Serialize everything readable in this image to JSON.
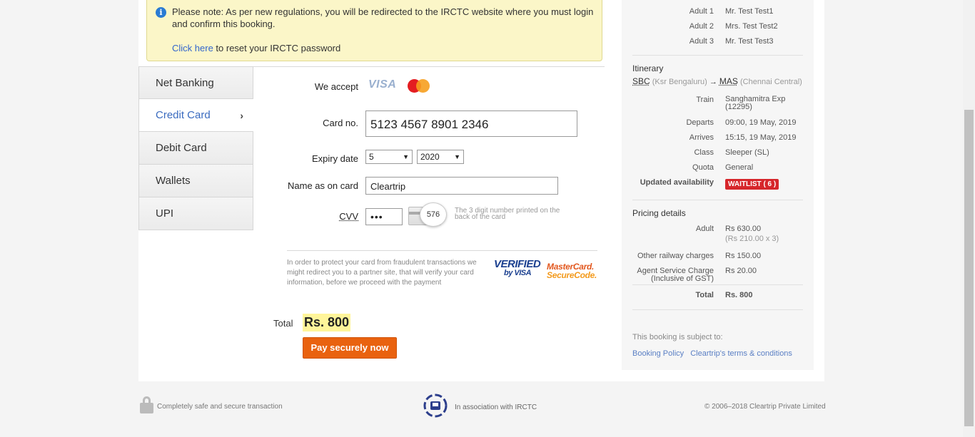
{
  "notice": {
    "message": "Please note: As per new regulations, you will be redirected to the IRCTC website where you must login and confirm this booking.",
    "reset_link": "Click here",
    "reset_text": " to reset your IRCTC password"
  },
  "tabs": [
    {
      "label": "Net Banking",
      "active": false
    },
    {
      "label": "Credit Card",
      "active": true
    },
    {
      "label": "Debit Card",
      "active": false
    },
    {
      "label": "Wallets",
      "active": false
    },
    {
      "label": "UPI",
      "active": false
    }
  ],
  "form": {
    "we_accept": "We accept",
    "visa": "VISA",
    "card_no_label": "Card no.",
    "card_no_value": "5123 4567 8901 2346",
    "expiry_label": "Expiry date",
    "expiry_month": "5",
    "expiry_year": "2020",
    "name_label": "Name as on card",
    "name_value": "Cleartrip",
    "cvv_label": "CVV",
    "cvv_value": "•••",
    "cvv_example": "576",
    "cvv_help": "The 3 digit number printed on the back of the card",
    "protect_text": "In order to protect your card from fraudulent transactions we might redirect you to a partner site, that will verify your card information, before we proceed with the payment",
    "vbv_top": "VERIFIED",
    "vbv_bottom": "by VISA",
    "mcsc_top": "MasterCard.",
    "mcsc_bottom": "SecureCode.",
    "total_label": "Total",
    "total_value": "Rs. 800",
    "pay_button": "Pay securely now"
  },
  "summary": {
    "travellers": [
      {
        "key": "Adult 1",
        "value": "Mr. Test Test1"
      },
      {
        "key": "Adult 2",
        "value": "Mrs. Test Test2"
      },
      {
        "key": "Adult 3",
        "value": "Mr. Test Test3"
      }
    ],
    "itinerary_title": "Itinerary",
    "from_code": "SBC",
    "from_name": "(Ksr Bengaluru)",
    "arrow": "→",
    "to_code": "MAS",
    "to_name": "(Chennai Central)",
    "details": [
      {
        "key": "Train",
        "value": "Sanghamitra Exp (12295)"
      },
      {
        "key": "Departs",
        "value": "09:00, 19 May, 2019"
      },
      {
        "key": "Arrives",
        "value": "15:15, 19 May, 2019"
      },
      {
        "key": "Class",
        "value": "Sleeper (SL)"
      },
      {
        "key": "Quota",
        "value": "General"
      }
    ],
    "availability_label": "Updated availability",
    "availability_badge": "WAITLIST ( 6 )",
    "pricing_title": "Pricing details",
    "adult_label": "Adult",
    "adult_value": "Rs 630.00",
    "adult_breakup": "(Rs 210.00 x 3)",
    "other_label": "Other railway charges",
    "other_value": "Rs 150.00",
    "agent_label": "Agent Service Charge",
    "agent_sub": "(Inclusive of GST)",
    "agent_value": "Rs 20.00",
    "total_label": "Total",
    "total_value": "Rs. 800",
    "subject_text": "This booking is subject to:",
    "booking_policy": "Booking Policy",
    "terms": "Cleartrip's terms & conditions"
  },
  "footer": {
    "secure": "Completely safe and secure transaction",
    "association": "In association with IRCTC",
    "copyright": "© 2006–2018 Cleartrip Private Limited"
  },
  "colors": {
    "accent": "#e9620f",
    "link": "#3366cc",
    "waitlist": "#d6262b",
    "notice_bg": "#fbf6c8"
  }
}
